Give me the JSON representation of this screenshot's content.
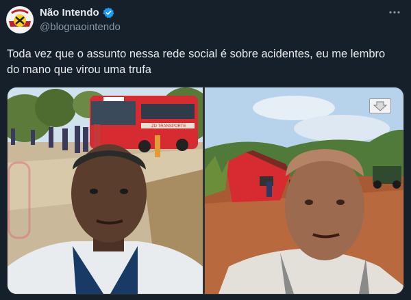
{
  "author": {
    "display_name": "Não Intendo",
    "handle": "@blognaointendo",
    "verified": true,
    "avatar_icon": "nao-intendo-logo"
  },
  "tweet": {
    "text": "Toda vez que o assunto nessa rede social é sobre acidentes, eu me lembro do mano que virou uma trufa"
  },
  "media": {
    "count": 2,
    "left_photo": {
      "bus_sign": "ZD TRANSPORTE"
    },
    "right_photo": {}
  },
  "colors": {
    "background": "#15202b",
    "text_primary": "#e7e9ea",
    "text_secondary": "#8b98a5",
    "verified_blue": "#1d9bf0",
    "bus_red": "#d62b31"
  },
  "icons": {
    "more": "more-options-icon",
    "verified": "verified-badge-icon",
    "download": "download-arrow-icon"
  }
}
